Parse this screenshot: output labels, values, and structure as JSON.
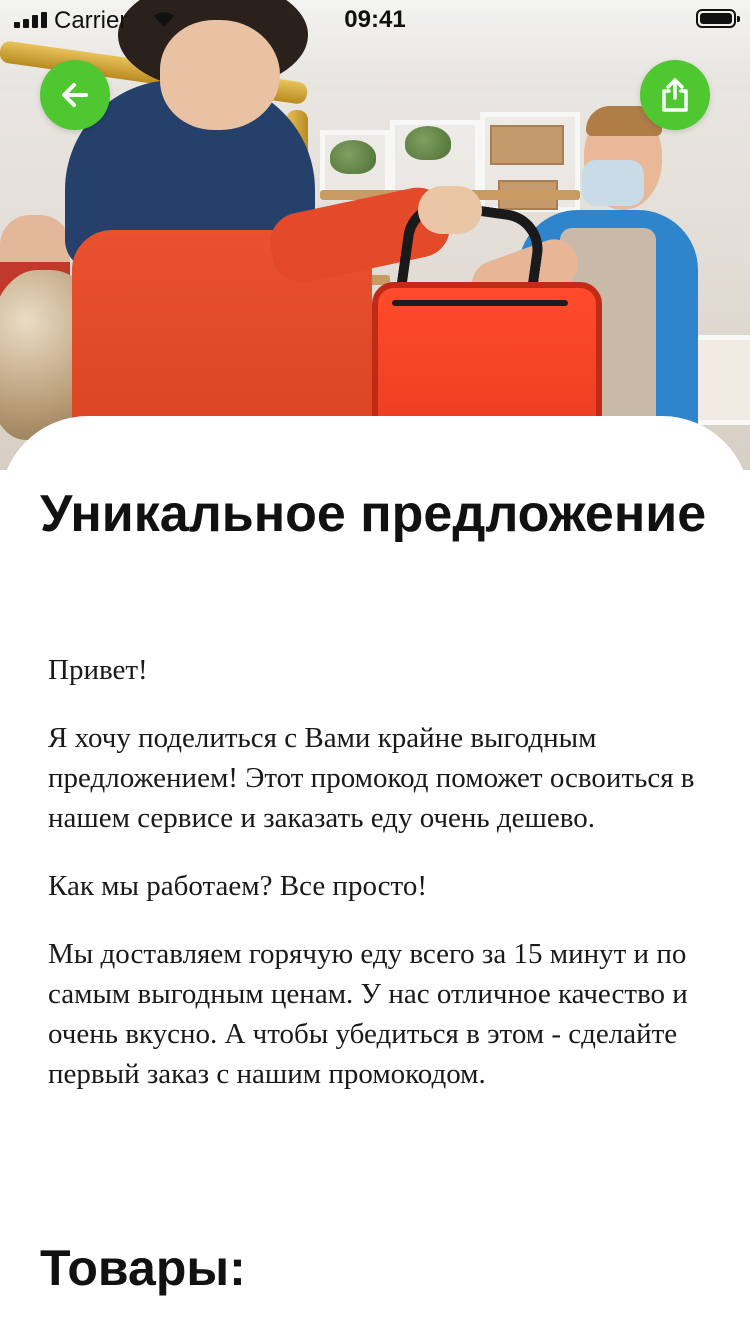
{
  "status_bar": {
    "carrier": "Carrier",
    "time": "09:41",
    "signal_bars": 4,
    "battery_level": 1.0
  },
  "hero": {
    "image": "courier-handing-red-delivery-bag-photo"
  },
  "nav": {
    "back_icon": "arrow-left-icon",
    "share_icon": "share-icon",
    "button_color": "#4fc730"
  },
  "article": {
    "title": "Уникальное предложение",
    "paragraphs": [
      "Привет!",
      "Я хочу поделиться с Вами крайне выгодным предложением! Этот промокод поможет освоиться в нашем сервисе и заказать еду очень дешево.",
      "Как мы работаем? Все просто!",
      "Мы доставляем горячую еду всего за 15 минут и по самым выгодным ценам. У нас отличное качество и очень вкусно. А чтобы убедиться в этом - сделайте первый заказ с нашим промокодом."
    ],
    "products_heading": "Товары:"
  }
}
